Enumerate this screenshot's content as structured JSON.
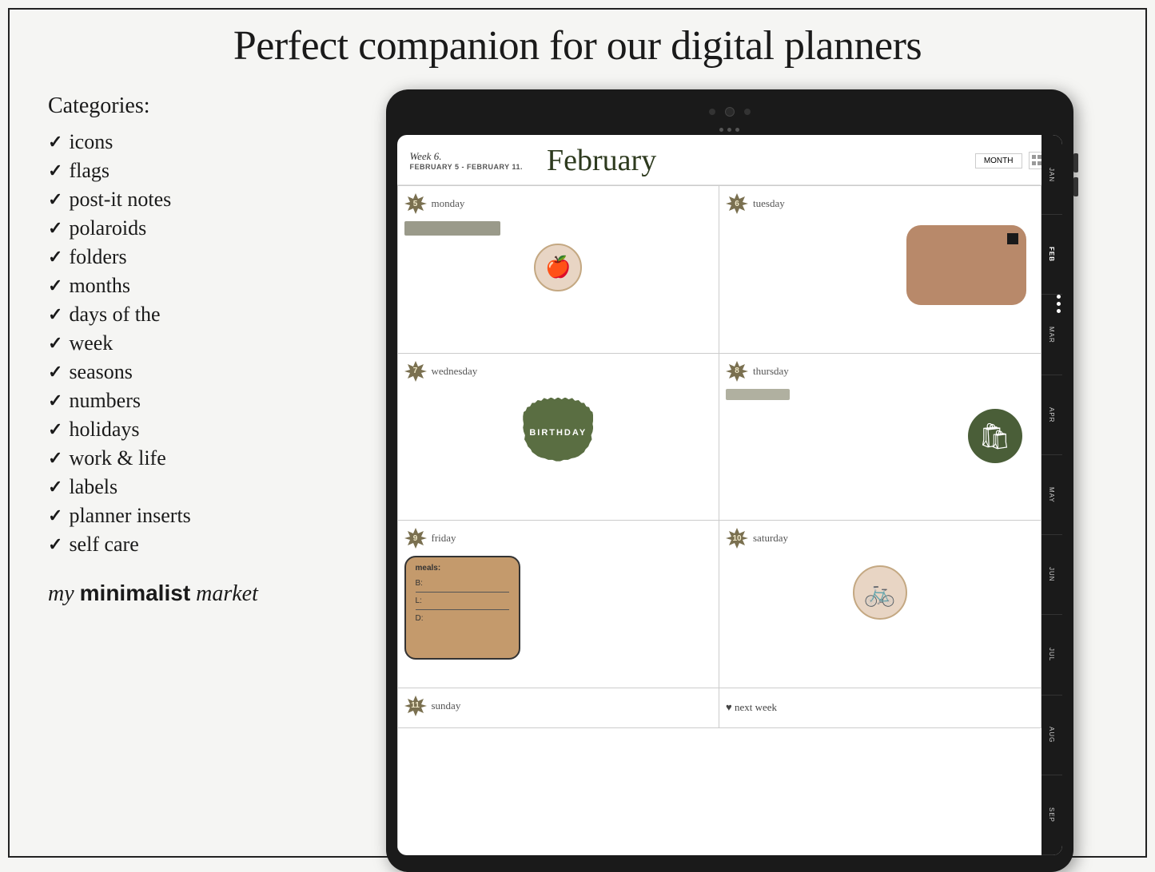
{
  "page": {
    "title": "Perfect companion for our digital planners",
    "background": "#f5f5f3"
  },
  "left_panel": {
    "categories_label": "Categories:",
    "items": [
      {
        "label": "icons"
      },
      {
        "label": "flags"
      },
      {
        "label": "post-it notes"
      },
      {
        "label": "polaroids"
      },
      {
        "label": "folders"
      },
      {
        "label": "months"
      },
      {
        "label": "days of the"
      },
      {
        "label": "week"
      },
      {
        "label": "seasons"
      },
      {
        "label": "numbers"
      },
      {
        "label": "holidays"
      },
      {
        "label": "work & life"
      },
      {
        "label": "labels"
      },
      {
        "label": "planner inserts"
      },
      {
        "label": "self care"
      }
    ],
    "brand": {
      "my": "my",
      "minimalist": "minimalist",
      "market": "market"
    }
  },
  "planner": {
    "week_label": "Week 6.",
    "date_range": "FEBRUARY 5 - FEBRUARY 11.",
    "month_title": "February",
    "month_btn": "MONTH",
    "days": [
      {
        "num": "5",
        "name": "monday"
      },
      {
        "num": "6",
        "name": "tuesday"
      },
      {
        "num": "7",
        "name": "wednesday"
      },
      {
        "num": "8",
        "name": "thursday"
      },
      {
        "num": "9",
        "name": "friday"
      },
      {
        "num": "10",
        "name": "saturday"
      },
      {
        "num": "11",
        "name": "sunday"
      },
      {
        "label": "♥ next week"
      }
    ],
    "sidebar_months": [
      "JAN",
      "FEB",
      "MAR",
      "APR",
      "MAY",
      "JUN",
      "JUL",
      "AUG",
      "SEP"
    ],
    "stickers": {
      "birthday": "BIRTHDAY",
      "meals": {
        "title": "meals:",
        "b": "B:",
        "l": "L:",
        "d": "D:"
      }
    }
  }
}
